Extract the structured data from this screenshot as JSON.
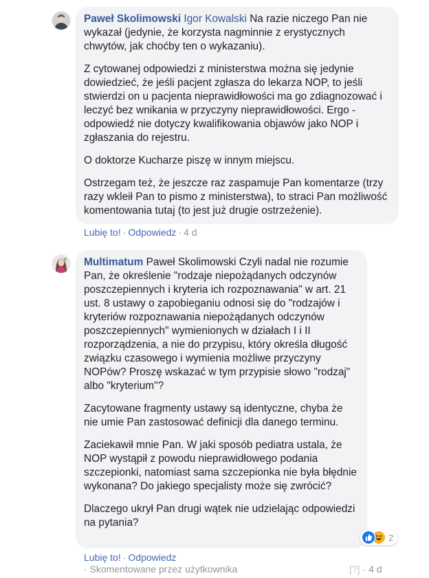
{
  "comments": [
    {
      "author": "Paweł Skolimowski",
      "mention": "Igor Kowalski",
      "paragraphs": [
        "Na razie niczego Pan nie wykazał (jedynie, że korzysta nagminnie z erystycznych chwytów, jak choćby ten o wykazaniu).",
        "Z cytowanej odpowiedzi z ministerstwa można się jedynie dowiedzieć, że jeśli pacjent zgłasza do lekarza NOP, to jeśli stwierdzi on u pacjenta nieprawidłowości ma go zdiagnozować i leczyć bez wnikania w przyczyny nieprawidłowości. Ergo - odpowiedź nie dotyczy kwalifikowania objawów jako NOP i zgłaszania do rejestru.",
        "O doktorze Kucharze piszę w innym miejscu.",
        "Ostrzegam też, że jeszcze raz zaspamuje Pan komentarze (trzy razy wkleił Pan to pismo z ministerstwa), to straci Pan możliwość komentowania tutaj (to jest już drugie ostrzeżenie)."
      ],
      "like_label": "Lubię to!",
      "reply_label": "Odpowiedz",
      "separator": "·",
      "time": "4 d"
    },
    {
      "author": "Multimatum",
      "mention": "Paweł Skolimowski",
      "paragraphs": [
        "Czyli nadal nie rozumie Pan, że określenie \"rodzaje niepożądanych odczynów poszczepiennych i kryteria ich rozpoznawania\" w art. 21 ust. 8 ustawy o zapobieganiu odnosi się do \"rodzajów i kryteriów rozpoznawania niepożądanych odczynów poszczepiennych\" wymienionych w działach I i II rozporządzenia, a nie do przypisu, który określa długość związku czasowego i wymienia możliwe przyczyny NOPów? Proszę wskazać w tym przypisie słowo \"rodzaj\" albo \"kryterium\"?",
        "Zacytowane fragmenty ustawy są identyczne, chyba że nie umie Pan zastosować definicji dla danego terminu.",
        "Zaciekawił mnie Pan. W jaki sposób pediatra ustala, że NOP wystąpił z powodu nieprawidłowego podania szczepionki, natomiast sama szczepionka nie była błędnie wykonana? Do jakiego specjalisty może się zwrócić?",
        "Dlaczego ukrył Pan drugi wątek nie udzielając odpowiedzi na pytania?"
      ],
      "like_label": "Lubię to!",
      "reply_label": "Odpowiedz",
      "separator": "·",
      "reactions_count": "2",
      "edited_label": "· Skomentowane przez użytkownika",
      "help_mark": "[?]",
      "time": "· 4 d"
    }
  ],
  "icons": {
    "reaction_like": "thumbs-up-icon",
    "reaction_haha": "laughing-face-icon"
  },
  "colors": {
    "link": "#385898",
    "action_link": "#4267b2",
    "bubble_bg": "#f2f3f5",
    "meta": "#90949c"
  }
}
